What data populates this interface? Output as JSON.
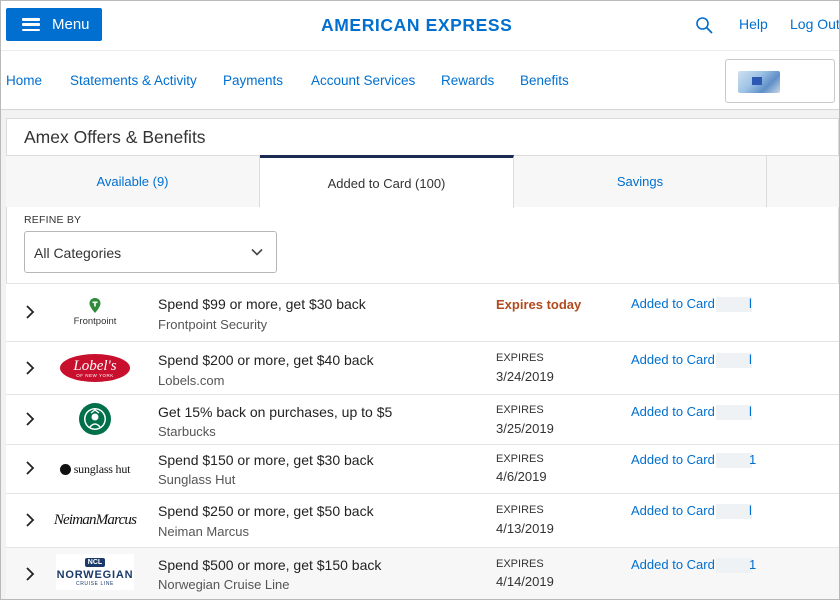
{
  "header": {
    "menu_label": "Menu",
    "brand": "AMERICAN EXPRESS",
    "help": "Help",
    "logout": "Log Out"
  },
  "nav": {
    "items": [
      "Home",
      "Statements & Activity",
      "Payments",
      "Account Services",
      "Rewards",
      "Benefits"
    ]
  },
  "panel": {
    "title": "Amex Offers & Benefits",
    "tabs": [
      {
        "label": "Available (9)",
        "active": false
      },
      {
        "label": "Added to Card (100)",
        "active": true
      },
      {
        "label": "Savings",
        "active": false
      }
    ],
    "refine_label": "REFINE BY",
    "category_select": {
      "value": "All Categories"
    }
  },
  "offers": [
    {
      "title": "Spend $99 or more, get $30 back",
      "merchant": "Frontpoint Security",
      "expires_today": "Expires today",
      "status": "Added to Card -",
      "tail": "l",
      "logo": "Frontpoint"
    },
    {
      "title": "Spend $200 or more, get $40 back",
      "merchant": "Lobels.com",
      "expires_label": "EXPIRES",
      "expires_date": "3/24/2019",
      "status": "Added to Card -",
      "tail": "l",
      "logo": "Lobel's"
    },
    {
      "title": "Get 15% back on purchases, up to $5",
      "merchant": "Starbucks",
      "expires_label": "EXPIRES",
      "expires_date": "3/25/2019",
      "status": "Added to Card -",
      "tail": "l",
      "logo": "starbucks-siren"
    },
    {
      "title": "Spend $150 or more, get $30 back",
      "merchant": "Sunglass Hut",
      "expires_label": "EXPIRES",
      "expires_date": "4/6/2019",
      "status": "Added to Card -",
      "tail": "1",
      "logo": "sunglass hut"
    },
    {
      "title": "Spend $250 or more, get $50 back",
      "merchant": "Neiman Marcus",
      "expires_label": "EXPIRES",
      "expires_date": "4/13/2019",
      "status": "Added to Card -",
      "tail": "l",
      "logo": "NeimanMarcus"
    },
    {
      "title": "Spend $500 or more, get $150 back",
      "merchant": "Norwegian Cruise Line",
      "expires_label": "EXPIRES",
      "expires_date": "4/14/2019",
      "status": "Added to Card -",
      "tail": "1",
      "logo": "NORWEGIAN"
    }
  ],
  "logo_text": {
    "frontpoint": "Frontpoint",
    "lobels": "Lobel's",
    "lobels_sub": "OF NEW YORK",
    "sunglass": "sunglass hut",
    "neiman": "NeimanMarcus",
    "ncl": "NCL",
    "norwegian": "NORWEGIAN",
    "norwegian_sub": "CRUISE LINE"
  },
  "colors": {
    "brand_blue": "#006fcf",
    "expires_today": "#b04a1f",
    "active_tab_border": "#1a2a50",
    "frontpoint_green": "#2e8b3a",
    "lobels_red": "#c8102e",
    "starbucks_green": "#00704a",
    "ncl_blue": "#1b3a6b"
  }
}
